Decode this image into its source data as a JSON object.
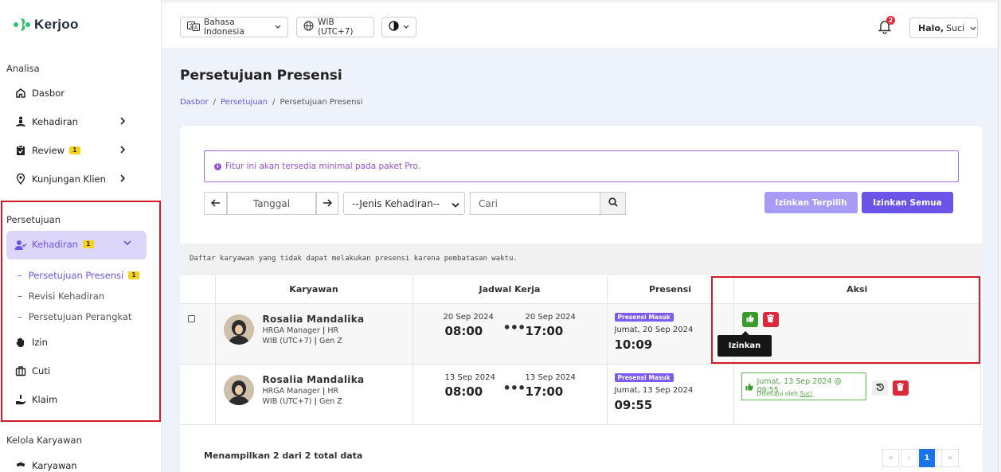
{
  "brand": {
    "name": "Kerjoo",
    "wordmark": "Kerjoo",
    "green": "#2fc26b"
  },
  "colors": {
    "accent": "#6b55e8",
    "danger": "#d31c2a",
    "success": "#3a9b2d",
    "badge": "#f7d21b"
  },
  "sidebar": {
    "section_analisa": "Analisa",
    "analisa_items": [
      {
        "label": "Dasbor",
        "icon": "home-icon"
      },
      {
        "label": "Kehadiran",
        "icon": "person-meditate-icon"
      },
      {
        "label": "Review",
        "badge": "1",
        "icon": "clipboard-check-icon"
      },
      {
        "label": "Kunjungan Klien",
        "icon": "location-pin-icon"
      }
    ],
    "section_persetujuan": "Persetujuan",
    "active_item": {
      "label": "Kehadiran",
      "badge": "1"
    },
    "sub_items": [
      {
        "label": "Persetujuan Presensi",
        "badge": "1"
      },
      {
        "label": "Revisi Kehadiran"
      },
      {
        "label": "Persetujuan Perangkat"
      }
    ],
    "persetujuan_items": [
      {
        "label": "Izin",
        "icon": "hand-icon"
      },
      {
        "label": "Cuti",
        "icon": "briefcase-icon"
      },
      {
        "label": "Klaim",
        "icon": "hand-coin-icon"
      }
    ],
    "section_kelola": "Kelola Karyawan",
    "kelola_items": [
      {
        "label": "Karyawan"
      }
    ]
  },
  "topbar": {
    "language": "Bahasa Indonesia",
    "timezone": "WIB (UTC+7)",
    "notification_count": "2",
    "greeting": "Halo,",
    "user_name": "Suci"
  },
  "main": {
    "title": "Persetujuan Presensi",
    "breadcrumb": [
      "Dasbor",
      "Persetujuan",
      "Persetujuan Presensi"
    ],
    "alert": "Fitur ini akan tersedia minimal pada paket Pro.",
    "filters": {
      "date_placeholder": "Tanggal",
      "type_selected": "--Jenis Kehadiran--",
      "search_placeholder": "Cari"
    },
    "buttons": {
      "approve_selected": "Izinkan Terpilih",
      "approve_all": "Izinkan Semua"
    },
    "info_text": "Daftar karyawan yang tidak dapat melakukan presensi karena pembatasan waktu.",
    "table": {
      "headers": [
        "Karyawan",
        "Jadwal Kerja",
        "Presensi",
        "Aksi"
      ],
      "rows": [
        {
          "name": "Rosalia Mandalika",
          "position": "HRGA Manager",
          "dept": "HR",
          "tz": "WIB (UTC+7)",
          "group": "Gen Z",
          "start_date": "20 Sep 2024",
          "start_time": "08:00",
          "end_date": "20 Sep 2024",
          "end_time": "17:00",
          "presence_type": "Presensi Masuk",
          "presence_day": "Jumat, 20 Sep 2024",
          "presence_time": "10:09",
          "status": "pending"
        },
        {
          "name": "Rosalia Mandalika",
          "position": "HRGA Manager",
          "dept": "HR",
          "tz": "WIB (UTC+7)",
          "group": "Gen Z",
          "start_date": "13 Sep 2024",
          "start_time": "08:00",
          "end_date": "13 Sep 2024",
          "end_time": "17:00",
          "presence_type": "Presensi Masuk",
          "presence_day": "Jumat, 13 Sep 2024",
          "presence_time": "09:55",
          "status": "approved",
          "approved_at": "Jumat, 13 Sep 2024 @ 09:55",
          "approved_by_prefix": "Disetujui oleh",
          "approved_by": "Suci"
        }
      ]
    },
    "tooltip": "Izinkan",
    "footer": "Menampilkan 2 dari 2 total data",
    "pagination": {
      "first": "«",
      "prev": "‹",
      "current": "1",
      "next": "›",
      "last": "»"
    }
  }
}
